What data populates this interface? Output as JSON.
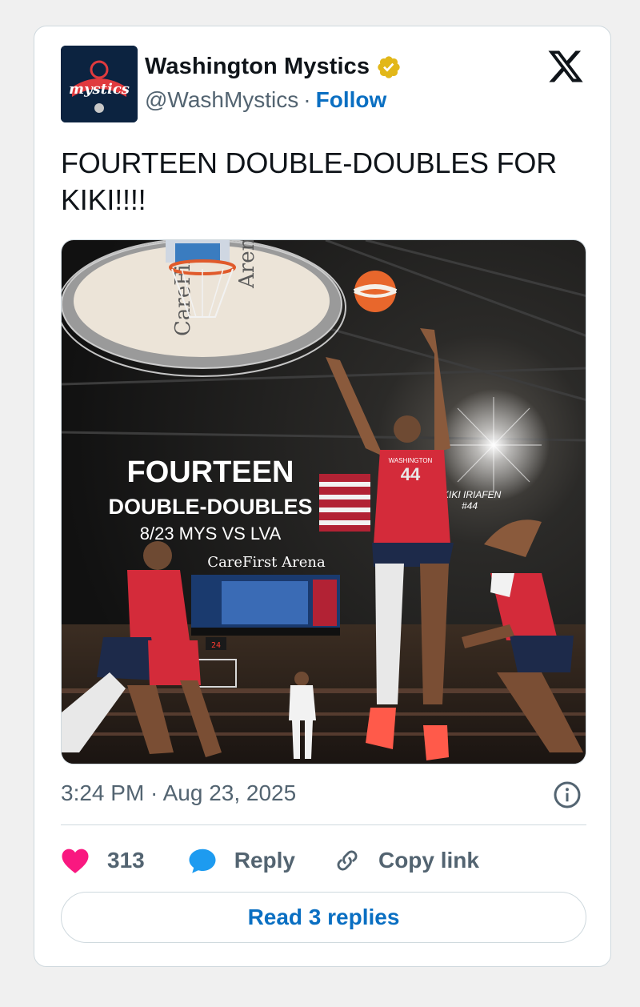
{
  "author": {
    "name": "Washington Mystics",
    "handle": "@WashMystics",
    "separator": "·",
    "follow_label": "Follow",
    "avatar_text": "mystics",
    "verified": true
  },
  "platform_icon": "x-logo-icon",
  "tweet": {
    "text": "FOURTEEN DOUBLE-DOUBLES FOR KIKI!!!!",
    "timestamp": "3:24 PM · Aug 23, 2025"
  },
  "media": {
    "headline": "FOURTEEN",
    "subheadline": "DOUBLE-DOUBLES",
    "game_line": "8/23 MYS VS LVA",
    "arena_banner": "CareFirst Arena",
    "player_caption_name": "KIKI IRIAFEN",
    "player_caption_number": "#44",
    "jersey_number": "44",
    "jersey_text": "WASHINGTON"
  },
  "actions": {
    "likes_count": "313",
    "reply_label": "Reply",
    "copy_link_label": "Copy link"
  },
  "read_replies_label": "Read 3 replies",
  "colors": {
    "like": "#f91880",
    "reply": "#1d9bf0",
    "link": "#0a6fc2",
    "verified": "#e2b719",
    "text_secondary": "#536471"
  }
}
